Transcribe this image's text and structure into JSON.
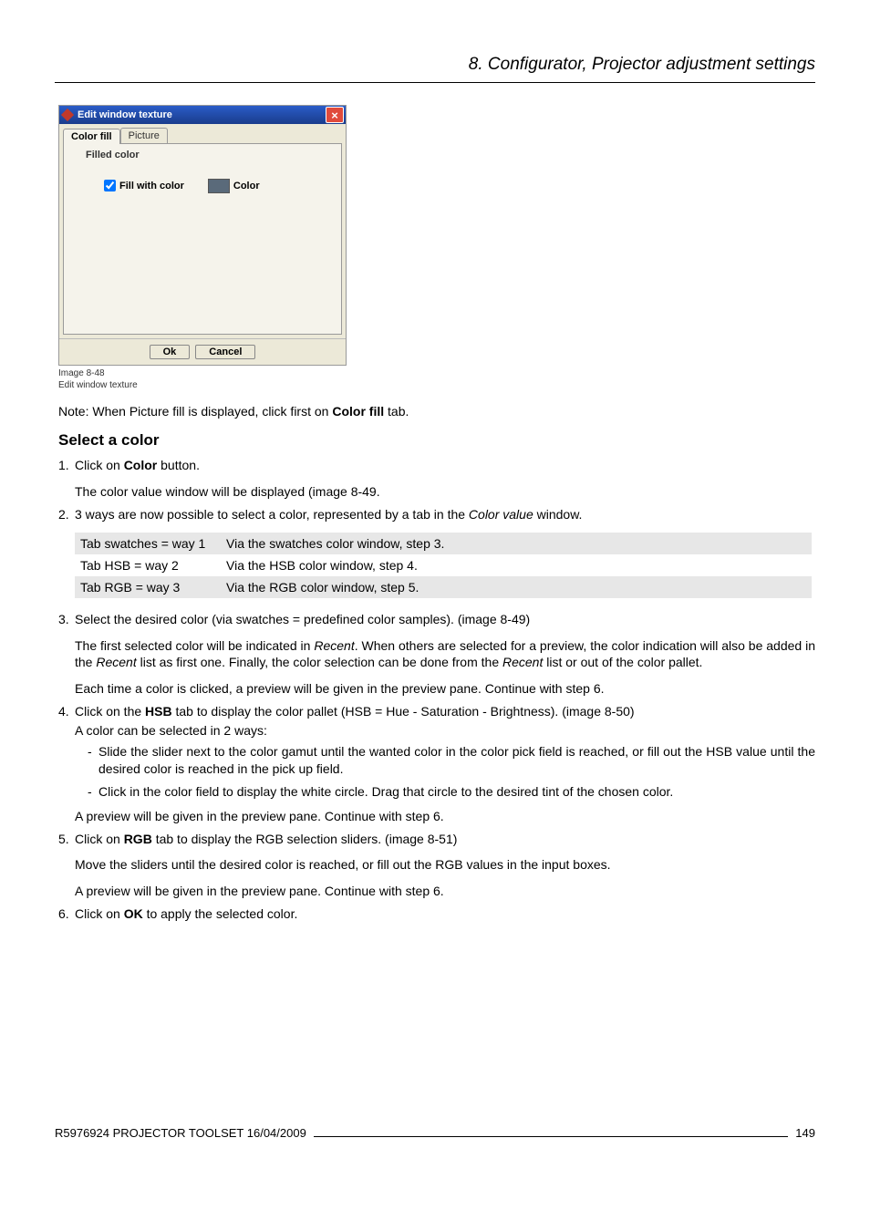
{
  "header": {
    "title": "8.  Configurator, Projector adjustment settings"
  },
  "screenshot": {
    "window_title": "Edit window texture",
    "tab_active": "Color fill",
    "tab_inactive": "Picture",
    "group_title": "Filled color",
    "checkbox_label": "Fill with color",
    "swatch_label": "Color",
    "btn_ok": "Ok",
    "btn_cancel": "Cancel"
  },
  "caption": {
    "line1": "Image 8-48",
    "line2": "Edit window texture"
  },
  "note": {
    "prefix": "Note:  When Picture fill is displayed, click first on ",
    "bold": "Color fill",
    "suffix": " tab."
  },
  "heading": "Select a color",
  "steps": {
    "s1": {
      "num": "1.",
      "p1a": "Click on ",
      "p1b": "Color",
      "p1c": " button.",
      "p2": "The color value window will be displayed (image 8-49."
    },
    "s2": {
      "num": "2.",
      "p1a": "3 ways are now possible to select a color, represented by a tab in the ",
      "p1b": "Color value",
      "p1c": " window."
    },
    "s3": {
      "num": "3.",
      "p1": "Select the desired color (via swatches = predefined color samples). (image 8-49)",
      "p2a": "The first selected color will be indicated in ",
      "p2b": "Recent",
      "p2c": ".  When others are selected for a preview, the color indication will also be added in the ",
      "p2d": "Recent",
      "p2e": " list as first one. Finally, the color selection can be done from the ",
      "p2f": "Recent",
      "p2g": " list or out of the color pallet.",
      "p3": "Each time a color is clicked, a preview will be given in the preview pane. Continue with step 6."
    },
    "s4": {
      "num": "4.",
      "p1a": "Click on the ",
      "p1b": "HSB",
      "p1c": " tab to display the color pallet (HSB = Hue - Saturation - Brightness). (image 8-50)",
      "p2": "A color can be selected in 2 ways:",
      "li1": "Slide the slider next to the color gamut until the wanted color in the color pick field is reached, or fill out the HSB value until the desired color is reached in the pick up field.",
      "li2": "Click in the color field to display the white circle.  Drag that circle to the desired tint of the chosen color.",
      "p3": "A preview will be given in the preview pane. Continue with step 6."
    },
    "s5": {
      "num": "5.",
      "p1a": "Click on ",
      "p1b": "RGB",
      "p1c": " tab to display the RGB selection sliders. (image 8-51)",
      "p2": "Move the sliders until the desired color is reached, or fill out the RGB values in the input boxes.",
      "p3": "A preview will be given in the preview pane. Continue with step 6."
    },
    "s6": {
      "num": "6.",
      "p1a": "Click on ",
      "p1b": "OK",
      "p1c": " to apply the selected color."
    }
  },
  "table": {
    "r1k": "Tab swatches = way 1",
    "r1v": "Via the swatches color window, step 3.",
    "r2k": "Tab HSB = way 2",
    "r2v": "Via the HSB color window, step 4.",
    "r3k": "Tab RGB = way 3",
    "r3v": "Via the RGB color window, step 5."
  },
  "footer": {
    "left": "R5976924  PROJECTOR TOOLSET  16/04/2009",
    "right": "149"
  }
}
